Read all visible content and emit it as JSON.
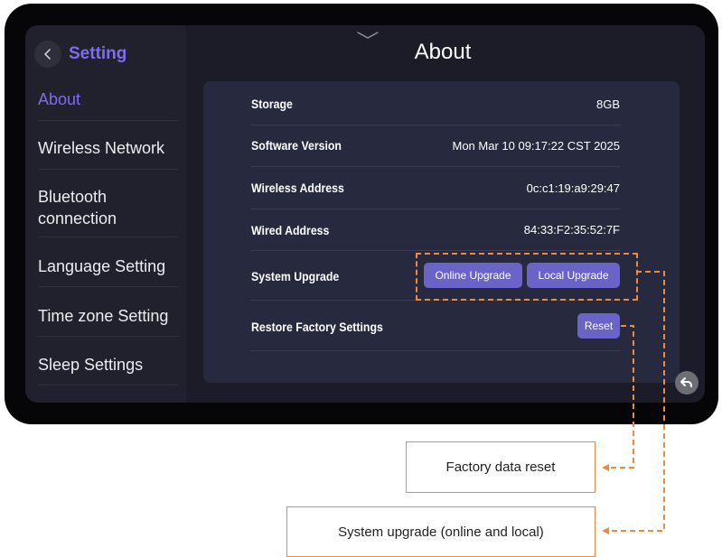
{
  "sidebar": {
    "title": "Setting",
    "items": [
      {
        "label": "About"
      },
      {
        "label": "Wireless Network"
      },
      {
        "label": "Bluetooth connection"
      },
      {
        "label": "Language Setting"
      },
      {
        "label": "Time zone Setting"
      },
      {
        "label": "Sleep Settings"
      }
    ]
  },
  "main": {
    "title": "About",
    "rows": [
      {
        "label": "Storage",
        "value": "8GB"
      },
      {
        "label": "Software Version",
        "value": "Mon Mar 10 09:17:22 CST 2025"
      },
      {
        "label": "Wireless Address",
        "value": "0c:c1:19:a9:29:47"
      },
      {
        "label": "Wired Address",
        "value": "84:33:F2:35:52:7F"
      },
      {
        "label": "System Upgrade"
      },
      {
        "label": "Restore Factory Settings"
      }
    ],
    "online_upgrade_label": "Online Upgrade",
    "local_upgrade_label": "Local Upgrade",
    "reset_label": "Reset"
  },
  "callouts": {
    "factory_reset": "Factory data reset",
    "system_upgrade": "System upgrade (online and local)"
  },
  "colors": {
    "accent": "#7e6cf5",
    "button": "#6a63c8",
    "annotation": "#ee8a3c"
  },
  "icons": [
    "back-chevron-icon",
    "pull-down-chevron-icon",
    "return-arrow-icon"
  ]
}
